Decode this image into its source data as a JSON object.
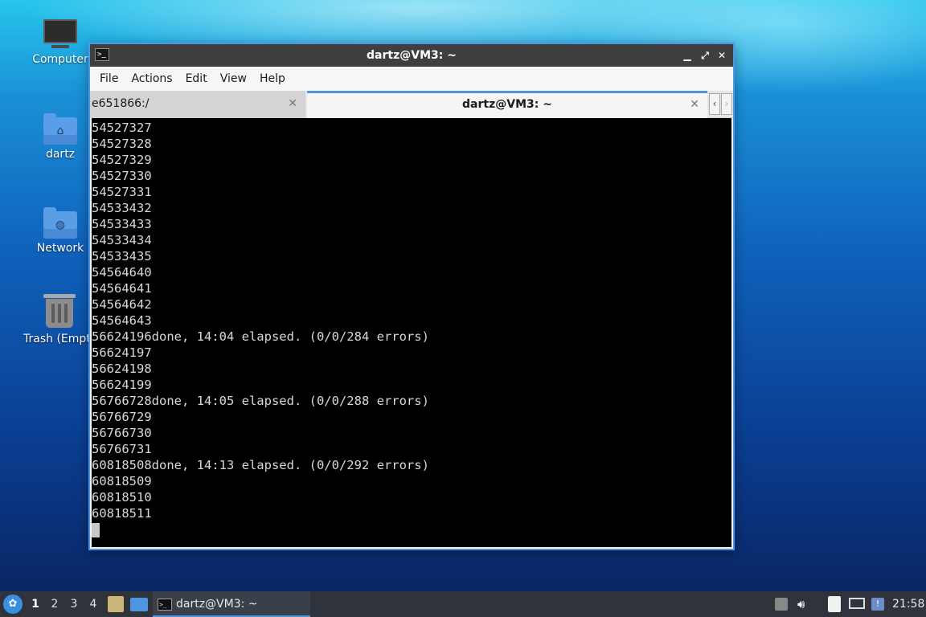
{
  "desktop": {
    "icons": [
      {
        "label": "Computer"
      },
      {
        "label": "dartz"
      },
      {
        "label": "Network"
      },
      {
        "label": "Trash (Empty)"
      }
    ]
  },
  "window": {
    "title": "dartz@VM3: ~",
    "menu": [
      "File",
      "Actions",
      "Edit",
      "View",
      "Help"
    ],
    "tabs": [
      {
        "label": "e651866:/",
        "active": false
      },
      {
        "label": "dartz@VM3: ~",
        "active": true
      }
    ],
    "terminal_lines": [
      "54527327",
      "54527328",
      "54527329",
      "54527330",
      "54527331",
      "54533432",
      "54533433",
      "54533434",
      "54533435",
      "54564640",
      "54564641",
      "54564642",
      "54564643",
      "56624196done, 14:04 elapsed. (0/0/284 errors)",
      "56624197",
      "56624198",
      "56624199",
      "56766728done, 14:05 elapsed. (0/0/288 errors)",
      "56766729",
      "56766730",
      "56766731",
      "60818508done, 14:13 elapsed. (0/0/292 errors)",
      "60818509",
      "60818510",
      "60818511"
    ]
  },
  "taskbar": {
    "workspaces": [
      "1",
      "2",
      "3",
      "4"
    ],
    "current_workspace": "1",
    "task_label": "dartz@VM3: ~",
    "clock": "21:58"
  },
  "colors": {
    "accent": "#4f93e3",
    "terminal_bg": "#000000",
    "terminal_fg": "#d8d8d8",
    "titlebar": "#3f3f3f",
    "taskbar": "#2f343c"
  }
}
